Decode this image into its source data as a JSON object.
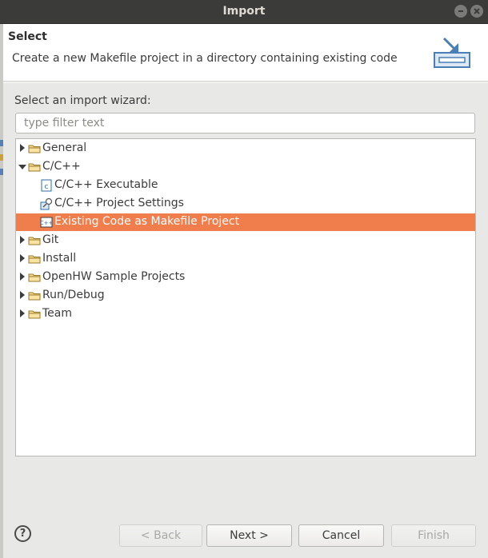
{
  "window": {
    "title": "Import"
  },
  "header": {
    "title": "Select",
    "description": "Create a new Makefile project in a directory containing existing code"
  },
  "wizard": {
    "label": "Select an import wizard:",
    "filter_placeholder": "type filter text",
    "filter_value": ""
  },
  "tree": {
    "items": [
      {
        "label": "General",
        "level": 0,
        "expandable": true,
        "expanded": false,
        "icon": "folder-icon"
      },
      {
        "label": "C/C++",
        "level": 0,
        "expandable": true,
        "expanded": true,
        "icon": "folder-icon"
      },
      {
        "label": "C/C++ Executable",
        "level": 1,
        "expandable": false,
        "icon": "c-executable-icon"
      },
      {
        "label": "C/C++ Project Settings",
        "level": 1,
        "expandable": false,
        "icon": "project-settings-icon"
      },
      {
        "label": "Existing Code as Makefile Project",
        "level": 1,
        "expandable": false,
        "icon": "cpp-makefile-icon",
        "selected": true
      },
      {
        "label": "Git",
        "level": 0,
        "expandable": true,
        "expanded": false,
        "icon": "folder-icon"
      },
      {
        "label": "Install",
        "level": 0,
        "expandable": true,
        "expanded": false,
        "icon": "folder-icon"
      },
      {
        "label": "OpenHW Sample Projects",
        "level": 0,
        "expandable": true,
        "expanded": false,
        "icon": "folder-icon"
      },
      {
        "label": "Run/Debug",
        "level": 0,
        "expandable": true,
        "expanded": false,
        "icon": "folder-icon"
      },
      {
        "label": "Team",
        "level": 0,
        "expandable": true,
        "expanded": false,
        "icon": "folder-icon"
      }
    ]
  },
  "buttons": {
    "help": "?",
    "back": "< Back",
    "next": "Next >",
    "cancel": "Cancel",
    "finish": "Finish"
  },
  "colors": {
    "selection": "#f07e4c",
    "titlebar": "#3b3b3a",
    "accent_icon": "#2f6ea8"
  }
}
